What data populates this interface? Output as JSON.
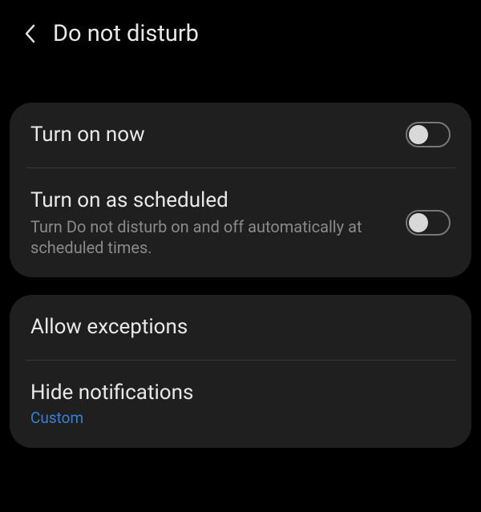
{
  "header": {
    "title": "Do not disturb"
  },
  "card1": {
    "rows": [
      {
        "title": "Turn on now"
      },
      {
        "title": "Turn on as scheduled",
        "sub": "Turn Do not disturb on and off automatically at scheduled times."
      }
    ]
  },
  "card2": {
    "rows": [
      {
        "title": "Allow exceptions"
      },
      {
        "title": "Hide notifications",
        "sub": "Custom"
      }
    ]
  }
}
